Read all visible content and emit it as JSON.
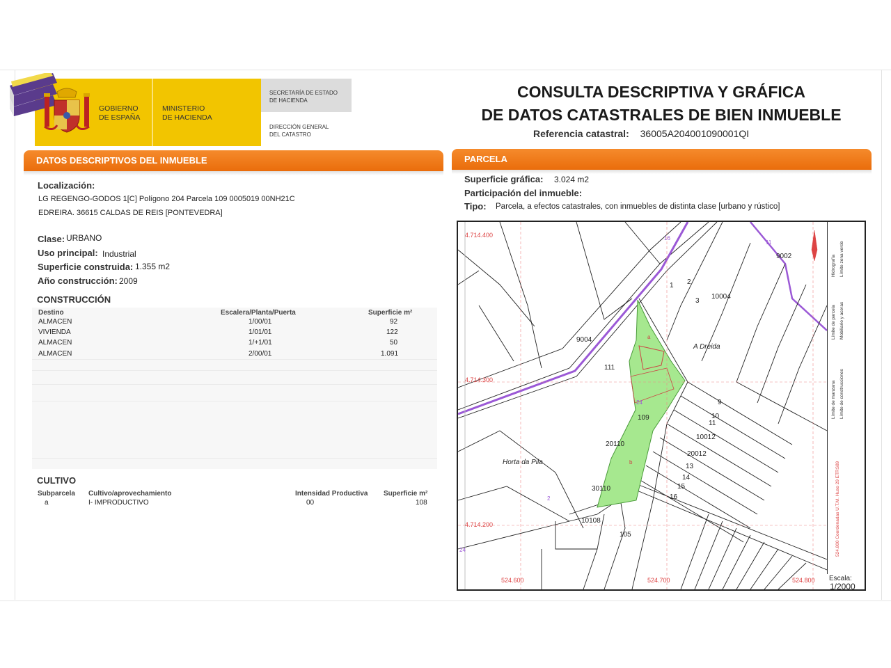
{
  "header": {
    "gobierno": [
      "GOBIERNO",
      "DE ESPAÑA"
    ],
    "ministerio": [
      "MINISTERIO",
      "DE HACIENDA"
    ],
    "secretaria": [
      "SECRETARÍA DE ESTADO",
      "DE HACIENDA"
    ],
    "direccion": [
      "DIRECCIÓN GENERAL",
      "DEL CATASTRO"
    ],
    "title_line1": "CONSULTA DESCRIPTIVA Y GRÁFICA",
    "title_line2": "DE DATOS CATASTRALES DE BIEN INMUEBLE",
    "ref_label": "Referencia catastral:",
    "ref_value": "36005A204001090001QI"
  },
  "left": {
    "bar_title": "DATOS DESCRIPTIVOS DEL INMUEBLE",
    "localizacion_label": "Localización:",
    "localizacion_line1": "LG REGENGO-GODOS 1[C] Polígono 204 Parcela 109 0005019 00NH21C",
    "localizacion_line2": "EDREIRA. 36615 CALDAS DE REIS [PONTEVEDRA]",
    "clase_label": "Clase:",
    "clase_value": "URBANO",
    "uso_label": "Uso principal:",
    "uso_value": "Industrial",
    "superficie_label": "Superficie construida:",
    "superficie_value": "1.355 m2",
    "anio_label": "Año construcción:",
    "anio_value": "2009",
    "construccion_title": "CONSTRUCCIÓN",
    "construccion_headers": [
      "Destino",
      "Escalera/Planta/Puerta",
      "Superficie m²"
    ],
    "construccion_rows": [
      [
        "ALMACEN",
        "1/00/01",
        "92"
      ],
      [
        "VIVIENDA",
        "1/01/01",
        "122"
      ],
      [
        "ALMACEN",
        "1/+1/01",
        "50"
      ],
      [
        "ALMACEN",
        "2/00/01",
        "1.091"
      ]
    ],
    "cultivo_title": "CULTIVO",
    "cultivo_headers": [
      "Subparcela",
      "Cultivo/aprovechamiento",
      "Intensidad Productiva",
      "Superficie m²"
    ],
    "cultivo_rows": [
      [
        "a",
        "I- IMPRODUCTIVO",
        "00",
        "108"
      ]
    ]
  },
  "right": {
    "bar_title": "PARCELA",
    "sup_grafica_label": "Superficie gráfica:",
    "sup_grafica_value": "3.024 m2",
    "participacion_label": "Participación del inmueble:",
    "tipo_label": "Tipo:",
    "tipo_value": "Parcela, a efectos catastrales, con inmuebles de distinta clase [urbano y rústico]"
  },
  "map": {
    "coords": {
      "n400": "4.714.400",
      "n300": "4.714.300",
      "n200": "4.714.200",
      "e600": "524.600",
      "e700": "524.700",
      "e800": "524.800"
    },
    "labels": {
      "p9002": "9002",
      "p9004": "9004",
      "p10004": "10004",
      "p111": "111",
      "p109": "109",
      "p20110": "20110",
      "p30110": "30110",
      "p10108": "10108",
      "p105": "105",
      "p10012": "10012",
      "p20012": "20012",
      "n1": "1",
      "n2": "2",
      "n3": "3",
      "n9": "9",
      "n10": "10",
      "n11": "11",
      "n13": "13",
      "n14": "14",
      "n15": "15",
      "n16": "16",
      "road16": "16",
      "road11": "11",
      "road2": "2",
      "road24": "24",
      "sub_a": "a",
      "sub_b": "b",
      "a_dreida": "A Dreida",
      "horta": "Horta da Pila"
    },
    "legend": [
      "Límite de manzana",
      "Límite de construcciones",
      "Límite de parcela",
      "Mobiliario y aceras",
      "Hidrografía",
      "Límite zona verde",
      "524.800 Coordenadas U.T.M. Huso 29 ETRS89"
    ],
    "scale_label": "Escala:",
    "scale_value": "1/2000",
    "colors": {
      "parcel": "#a6e88f",
      "road": "#9b59d6",
      "coords": "#e05050"
    }
  }
}
